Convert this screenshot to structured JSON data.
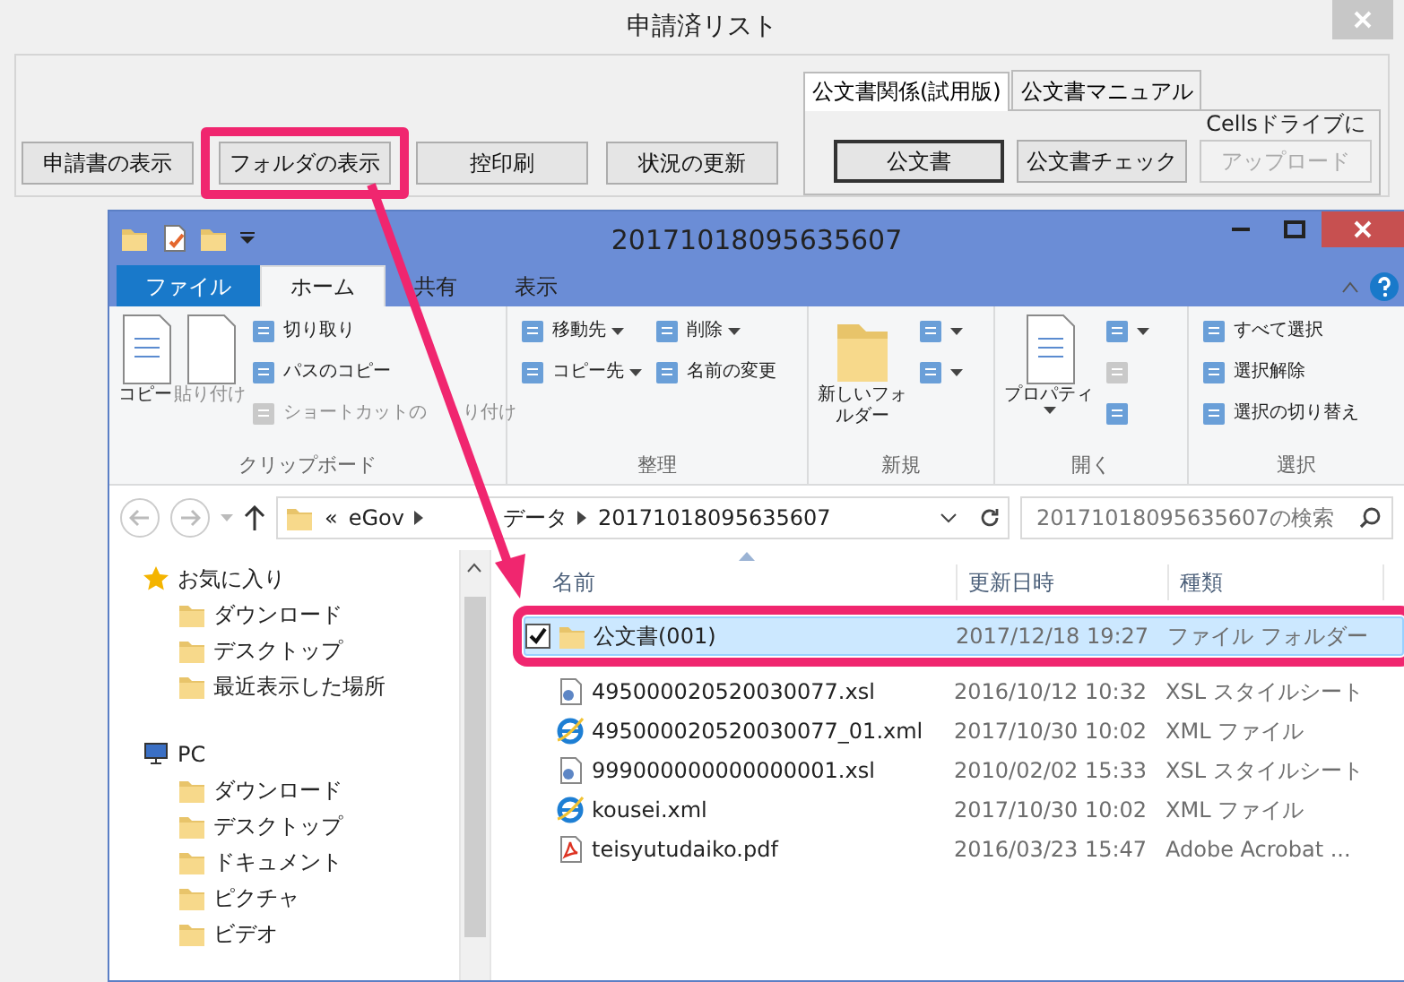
{
  "app": {
    "title": "申請済リスト",
    "buttons": [
      {
        "label": "申請書の表示",
        "highlighted": false
      },
      {
        "label": "フォルダの表示",
        "highlighted": true
      },
      {
        "label": "控印刷",
        "highlighted": false
      },
      {
        "label": "状況の更新",
        "highlighted": false
      }
    ],
    "tabs": [
      {
        "label": "公文書関係(試用版)",
        "selected": true
      },
      {
        "label": "公文書マニュアル",
        "selected": false
      }
    ],
    "upload_caption": "Cellsドライブに",
    "tab_buttons": [
      {
        "label": "公文書",
        "disabled": false,
        "default": true
      },
      {
        "label": "公文書チェック",
        "disabled": false,
        "default": false
      },
      {
        "label": "アップロード",
        "disabled": true,
        "default": false
      }
    ]
  },
  "explorer": {
    "title": "20171018095635607",
    "ribbon_tabs": [
      {
        "label": "ファイル",
        "kind": "file",
        "selected": false
      },
      {
        "label": "ホーム",
        "kind": "tab",
        "selected": true
      },
      {
        "label": "共有",
        "kind": "tab",
        "selected": false
      },
      {
        "label": "表示",
        "kind": "tab",
        "selected": false
      }
    ],
    "groups": [
      {
        "label": "クリップボード",
        "items": [
          {
            "label": "コピー",
            "kind": "large",
            "disabled": false,
            "menu": false
          },
          {
            "label": "貼り付け",
            "kind": "large",
            "disabled": true,
            "menu": false
          },
          {
            "label": "切り取り",
            "kind": "small",
            "disabled": false,
            "menu": false
          },
          {
            "label": "パスのコピー",
            "kind": "small",
            "disabled": false,
            "menu": false
          },
          {
            "label": "ショートカットの",
            "label_2": "り付け",
            "kind": "small",
            "disabled": true,
            "menu": false
          }
        ]
      },
      {
        "label": "整理",
        "items": [
          {
            "label": "移動先",
            "kind": "small",
            "disabled": false,
            "menu": true
          },
          {
            "label": "コピー先",
            "kind": "small",
            "disabled": false,
            "menu": true
          },
          {
            "label": "削除",
            "kind": "small",
            "disabled": false,
            "menu": true
          },
          {
            "label": "名前の変更",
            "kind": "small",
            "disabled": false,
            "menu": false
          }
        ]
      },
      {
        "label": "新規",
        "items": [
          {
            "label": "新しいフォルダー",
            "kind": "large",
            "disabled": false,
            "menu": false
          },
          {
            "kind": "small",
            "disabled": false,
            "menu": true
          },
          {
            "kind": "small",
            "disabled": false,
            "menu": true
          }
        ]
      },
      {
        "label": "開く",
        "items": [
          {
            "label": "プロパティ",
            "kind": "large",
            "disabled": false,
            "menu": true
          },
          {
            "kind": "small",
            "disabled": false,
            "menu": true
          },
          {
            "kind": "small",
            "disabled": true,
            "menu": false
          },
          {
            "kind": "small",
            "disabled": false,
            "menu": false
          }
        ]
      },
      {
        "label": "選択",
        "items": [
          {
            "label": "すべて選択",
            "kind": "small",
            "disabled": false,
            "menu": false
          },
          {
            "label": "選択解除",
            "kind": "small",
            "disabled": false,
            "menu": false
          },
          {
            "label": "選択の切り替え",
            "kind": "small",
            "disabled": false,
            "menu": false
          }
        ]
      }
    ],
    "path": [
      "«",
      "eGov",
      "データ",
      "20171018095635607"
    ],
    "search": {
      "placeholder": "20171018095635607の検索"
    },
    "nav": [
      {
        "label": "お気に入り",
        "kind": "favorites",
        "children": [
          {
            "label": "ダウンロード"
          },
          {
            "label": "デスクトップ"
          },
          {
            "label": "最近表示した場所"
          }
        ]
      },
      {
        "label": "PC",
        "kind": "pc",
        "children": [
          {
            "label": "ダウンロード"
          },
          {
            "label": "デスクトップ"
          },
          {
            "label": "ドキュメント"
          },
          {
            "label": "ピクチャ"
          },
          {
            "label": "ビデオ"
          }
        ]
      }
    ],
    "columns": [
      "名前",
      "更新日時",
      "種類"
    ],
    "rows": [
      {
        "name": "公文書(001)",
        "date": "2017/12/18 19:27",
        "type": "ファイル フォルダー",
        "kind": "folder",
        "selected": true,
        "checked": true,
        "highlighted": true
      },
      {
        "name": "495000020520030077.xsl",
        "date": "2016/10/12 10:32",
        "type": "XSL スタイルシート",
        "kind": "xsl",
        "selected": false,
        "checked": false,
        "highlighted": false
      },
      {
        "name": "495000020520030077_01.xml",
        "date": "2017/10/30 10:02",
        "type": "XML ファイル",
        "kind": "xml",
        "selected": false,
        "checked": false,
        "highlighted": false
      },
      {
        "name": "999000000000000001.xsl",
        "date": "2010/02/02 15:33",
        "type": "XSL スタイルシート",
        "kind": "xsl",
        "selected": false,
        "checked": false,
        "highlighted": false
      },
      {
        "name": "kousei.xml",
        "date": "2017/10/30 10:02",
        "type": "XML ファイル",
        "kind": "xml",
        "selected": false,
        "checked": false,
        "highlighted": false
      },
      {
        "name": "teisyutudaiko.pdf",
        "date": "2016/03/23 15:47",
        "type": "Adobe Acrobat ...",
        "kind": "pdf",
        "selected": false,
        "checked": false,
        "highlighted": false
      }
    ]
  }
}
